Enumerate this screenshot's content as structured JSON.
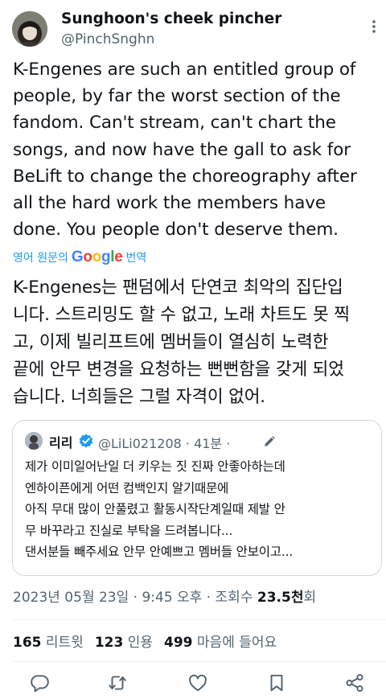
{
  "author": {
    "name": "Sunghoon's cheek pincher",
    "handle": "@PinchSnghn"
  },
  "tweet": {
    "lines": [
      "K-Engenes are such an entitled group of",
      "people, by far the worst section of the",
      "fandom. Can't stream, can't chart the",
      "songs, and now have the gall to ask for",
      "BeLift to change the choreography after",
      "all the hard work the members have",
      "done. You people don't deserve them."
    ]
  },
  "translation_bar": {
    "prefix": "영어 원문의",
    "logo": "Google",
    "suffix": "번역"
  },
  "translated": {
    "lines": [
      "K-Engenes는 팬덤에서 단연코 최악의 집단입",
      "니다. 스트리밍도 할 수 없고, 노래 차트도 못 찍",
      "고, 이제 빌리프트에 멤버들이 열심히 노력한",
      "끝에 안무 변경을 요청하는 뻔뻔함을 갖게 되었",
      "습니다. 너희들은 그럴 자격이 없어."
    ]
  },
  "quote": {
    "name": "리리",
    "handle": "@LiLi021208",
    "time": "· 41분 ·",
    "lines": [
      "제가 이미일어난일 더 키우는 짓 진짜 안좋아하는데",
      "엔하이픈에게 어떤 컴백인지 알기때문에",
      "아직 무대 많이 안풀렸고 활동시작단계일때 제발 안",
      "무 바꾸라고 진실로 부탁을 드려봅니다...",
      "댄서분들 빼주세요 안무 안예쁘고 멤버들 안보이고..."
    ]
  },
  "meta": {
    "date": "2023년 05월 23일 · 9:45 오후 · 조회수 ",
    "views": "23.5천",
    "views_suffix": "회"
  },
  "stats": {
    "retweets": "165",
    "retweets_label": "리트윗",
    "quotes": "123",
    "quotes_label": "인용",
    "likes": "499",
    "likes_label": "마음에 들어요"
  },
  "icons": {
    "more": "more-icon",
    "verified": "verified-badge-icon",
    "edited": "edit-pencil-icon",
    "reply": "reply-icon",
    "retweet": "retweet-icon",
    "like": "heart-icon",
    "bookmark": "bookmark-icon",
    "share": "share-icon"
  },
  "colors": {
    "accent": "#1d9bf0",
    "text": "#0f1419",
    "secondary": "#536471",
    "border": "#cfd9de"
  }
}
